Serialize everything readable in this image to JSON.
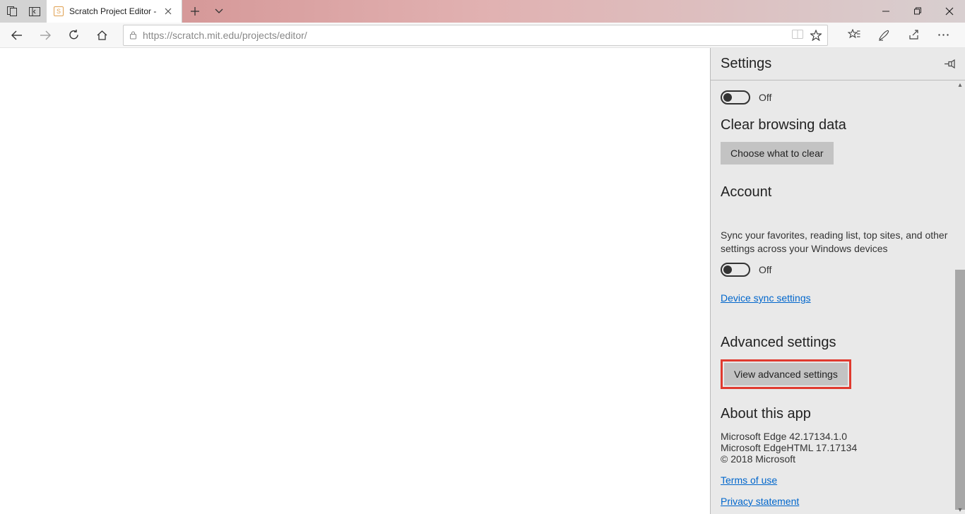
{
  "tab": {
    "title": "Scratch Project Editor -"
  },
  "address": {
    "url": "https://scratch.mit.edu/projects/editor/"
  },
  "settings": {
    "title": "Settings",
    "toggle1": {
      "state": "Off"
    },
    "clear_heading": "Clear browsing data",
    "clear_button": "Choose what to clear",
    "account_heading": "Account",
    "sync_text": "Sync your favorites, reading list, top sites, and other settings across your Windows devices",
    "toggle2": {
      "state": "Off"
    },
    "device_sync_link": "Device sync settings",
    "advanced_heading": "Advanced settings",
    "advanced_button": "View advanced settings",
    "about_heading": "About this app",
    "about_line1": "Microsoft Edge 42.17134.1.0",
    "about_line2": "Microsoft EdgeHTML 17.17134",
    "about_line3": "© 2018 Microsoft",
    "terms_link": "Terms of use",
    "privacy_link": "Privacy statement"
  }
}
